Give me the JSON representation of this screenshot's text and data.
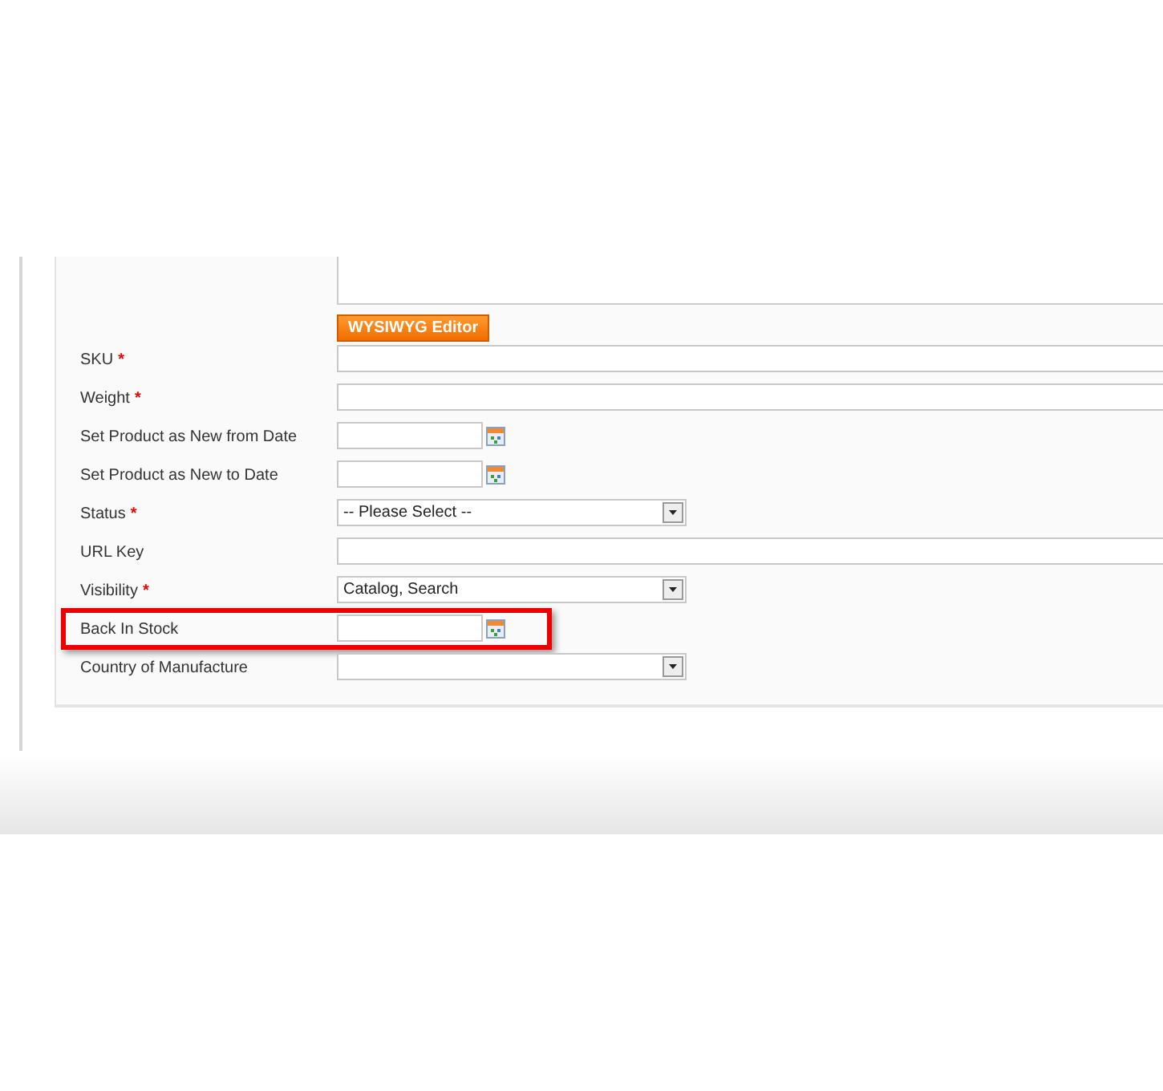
{
  "editor_button": "WYSIWYG Editor",
  "fields": [
    {
      "label": "SKU",
      "required": true,
      "kind": "text",
      "highlighted": false
    },
    {
      "label": "Weight",
      "required": true,
      "kind": "text",
      "highlighted": false
    },
    {
      "label": "Set Product as New from Date",
      "required": false,
      "kind": "date",
      "highlighted": false
    },
    {
      "label": "Set Product as New to Date",
      "required": false,
      "kind": "date",
      "highlighted": false
    },
    {
      "label": "Status",
      "required": true,
      "kind": "select",
      "value": "-- Please Select --",
      "highlighted": false
    },
    {
      "label": "URL Key",
      "required": false,
      "kind": "text",
      "highlighted": false
    },
    {
      "label": "Visibility",
      "required": true,
      "kind": "select",
      "value": "Catalog, Search",
      "highlighted": false
    },
    {
      "label": "Back In Stock",
      "required": false,
      "kind": "date",
      "highlighted": true
    },
    {
      "label": "Country of Manufacture",
      "required": false,
      "kind": "select",
      "highlighted": false
    }
  ],
  "required_mark": "*"
}
